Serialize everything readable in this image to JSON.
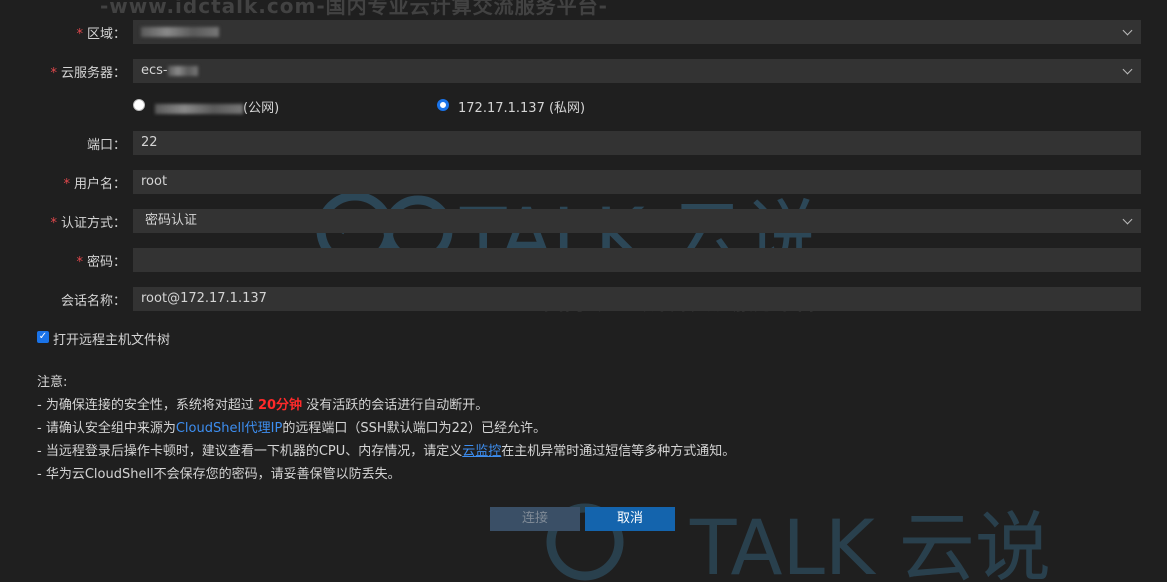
{
  "watermark": {
    "site_text": "-www.idctalk.com-国内专业云计算交流服务平台-",
    "logo_text": "TALK 云说"
  },
  "form": {
    "region": {
      "label": "区域：",
      "required_mark": "*",
      "value": ""
    },
    "server": {
      "label": "云服务器：",
      "required_mark": "*",
      "value": "ecs-"
    },
    "ip_options": [
      {
        "label": "(公网)",
        "selected": false
      },
      {
        "label": "172.17.1.137 (私网)",
        "selected": true
      }
    ],
    "port": {
      "label": "端口：",
      "value": "22"
    },
    "username": {
      "label": "用户名：",
      "required_mark": "*",
      "value": "root"
    },
    "auth_method": {
      "label": "认证方式：",
      "required_mark": "*",
      "value": "密码认证"
    },
    "password": {
      "label": "密码：",
      "required_mark": "*",
      "value": ""
    },
    "session_name": {
      "label": "会话名称：",
      "value": "root@172.17.1.137"
    },
    "file_tree": {
      "label": "打开远程主机文件树",
      "checked": true
    }
  },
  "notes": {
    "title": "注意:",
    "line1_a": "- 为确保连接的安全性，系统将对超过 ",
    "line1_highlight": "20分钟",
    "line1_b": " 没有活跃的会话进行自动断开。",
    "line2_a": "- 请确认安全组中来源为",
    "line2_link": "CloudShell代理IP",
    "line2_b": "的远程端口（SSH默认端口为22）已经允许。",
    "line3_a": "- 当远程登录后操作卡顿时，建议查看一下机器的CPU、内存情况，请定义",
    "line3_link": "云监控",
    "line3_b": "在主机异常时通过短信等多种方式通知。",
    "line4": "- 华为云CloudShell不会保存您的密码，请妥善保管以防丢失。"
  },
  "buttons": {
    "connect": "连接",
    "cancel": "取消"
  },
  "colors": {
    "background": "#1f1f1f",
    "field": "#333333",
    "accent": "#1a73e8",
    "required": "#e5484d",
    "highlight": "#ff2a2a",
    "link": "#3d8ef0"
  }
}
